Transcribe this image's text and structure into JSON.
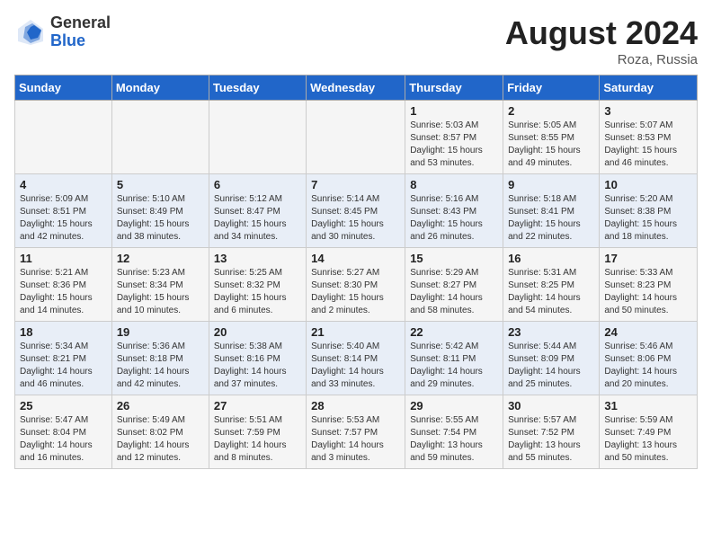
{
  "logo": {
    "general": "General",
    "blue": "Blue"
  },
  "title": "August 2024",
  "location": "Roza, Russia",
  "days_of_week": [
    "Sunday",
    "Monday",
    "Tuesday",
    "Wednesday",
    "Thursday",
    "Friday",
    "Saturday"
  ],
  "weeks": [
    [
      {
        "day": "",
        "info": ""
      },
      {
        "day": "",
        "info": ""
      },
      {
        "day": "",
        "info": ""
      },
      {
        "day": "",
        "info": ""
      },
      {
        "day": "1",
        "info": "Sunrise: 5:03 AM\nSunset: 8:57 PM\nDaylight: 15 hours\nand 53 minutes."
      },
      {
        "day": "2",
        "info": "Sunrise: 5:05 AM\nSunset: 8:55 PM\nDaylight: 15 hours\nand 49 minutes."
      },
      {
        "day": "3",
        "info": "Sunrise: 5:07 AM\nSunset: 8:53 PM\nDaylight: 15 hours\nand 46 minutes."
      }
    ],
    [
      {
        "day": "4",
        "info": "Sunrise: 5:09 AM\nSunset: 8:51 PM\nDaylight: 15 hours\nand 42 minutes."
      },
      {
        "day": "5",
        "info": "Sunrise: 5:10 AM\nSunset: 8:49 PM\nDaylight: 15 hours\nand 38 minutes."
      },
      {
        "day": "6",
        "info": "Sunrise: 5:12 AM\nSunset: 8:47 PM\nDaylight: 15 hours\nand 34 minutes."
      },
      {
        "day": "7",
        "info": "Sunrise: 5:14 AM\nSunset: 8:45 PM\nDaylight: 15 hours\nand 30 minutes."
      },
      {
        "day": "8",
        "info": "Sunrise: 5:16 AM\nSunset: 8:43 PM\nDaylight: 15 hours\nand 26 minutes."
      },
      {
        "day": "9",
        "info": "Sunrise: 5:18 AM\nSunset: 8:41 PM\nDaylight: 15 hours\nand 22 minutes."
      },
      {
        "day": "10",
        "info": "Sunrise: 5:20 AM\nSunset: 8:38 PM\nDaylight: 15 hours\nand 18 minutes."
      }
    ],
    [
      {
        "day": "11",
        "info": "Sunrise: 5:21 AM\nSunset: 8:36 PM\nDaylight: 15 hours\nand 14 minutes."
      },
      {
        "day": "12",
        "info": "Sunrise: 5:23 AM\nSunset: 8:34 PM\nDaylight: 15 hours\nand 10 minutes."
      },
      {
        "day": "13",
        "info": "Sunrise: 5:25 AM\nSunset: 8:32 PM\nDaylight: 15 hours\nand 6 minutes."
      },
      {
        "day": "14",
        "info": "Sunrise: 5:27 AM\nSunset: 8:30 PM\nDaylight: 15 hours\nand 2 minutes."
      },
      {
        "day": "15",
        "info": "Sunrise: 5:29 AM\nSunset: 8:27 PM\nDaylight: 14 hours\nand 58 minutes."
      },
      {
        "day": "16",
        "info": "Sunrise: 5:31 AM\nSunset: 8:25 PM\nDaylight: 14 hours\nand 54 minutes."
      },
      {
        "day": "17",
        "info": "Sunrise: 5:33 AM\nSunset: 8:23 PM\nDaylight: 14 hours\nand 50 minutes."
      }
    ],
    [
      {
        "day": "18",
        "info": "Sunrise: 5:34 AM\nSunset: 8:21 PM\nDaylight: 14 hours\nand 46 minutes."
      },
      {
        "day": "19",
        "info": "Sunrise: 5:36 AM\nSunset: 8:18 PM\nDaylight: 14 hours\nand 42 minutes."
      },
      {
        "day": "20",
        "info": "Sunrise: 5:38 AM\nSunset: 8:16 PM\nDaylight: 14 hours\nand 37 minutes."
      },
      {
        "day": "21",
        "info": "Sunrise: 5:40 AM\nSunset: 8:14 PM\nDaylight: 14 hours\nand 33 minutes."
      },
      {
        "day": "22",
        "info": "Sunrise: 5:42 AM\nSunset: 8:11 PM\nDaylight: 14 hours\nand 29 minutes."
      },
      {
        "day": "23",
        "info": "Sunrise: 5:44 AM\nSunset: 8:09 PM\nDaylight: 14 hours\nand 25 minutes."
      },
      {
        "day": "24",
        "info": "Sunrise: 5:46 AM\nSunset: 8:06 PM\nDaylight: 14 hours\nand 20 minutes."
      }
    ],
    [
      {
        "day": "25",
        "info": "Sunrise: 5:47 AM\nSunset: 8:04 PM\nDaylight: 14 hours\nand 16 minutes."
      },
      {
        "day": "26",
        "info": "Sunrise: 5:49 AM\nSunset: 8:02 PM\nDaylight: 14 hours\nand 12 minutes."
      },
      {
        "day": "27",
        "info": "Sunrise: 5:51 AM\nSunset: 7:59 PM\nDaylight: 14 hours\nand 8 minutes."
      },
      {
        "day": "28",
        "info": "Sunrise: 5:53 AM\nSunset: 7:57 PM\nDaylight: 14 hours\nand 3 minutes."
      },
      {
        "day": "29",
        "info": "Sunrise: 5:55 AM\nSunset: 7:54 PM\nDaylight: 13 hours\nand 59 minutes."
      },
      {
        "day": "30",
        "info": "Sunrise: 5:57 AM\nSunset: 7:52 PM\nDaylight: 13 hours\nand 55 minutes."
      },
      {
        "day": "31",
        "info": "Sunrise: 5:59 AM\nSunset: 7:49 PM\nDaylight: 13 hours\nand 50 minutes."
      }
    ]
  ]
}
